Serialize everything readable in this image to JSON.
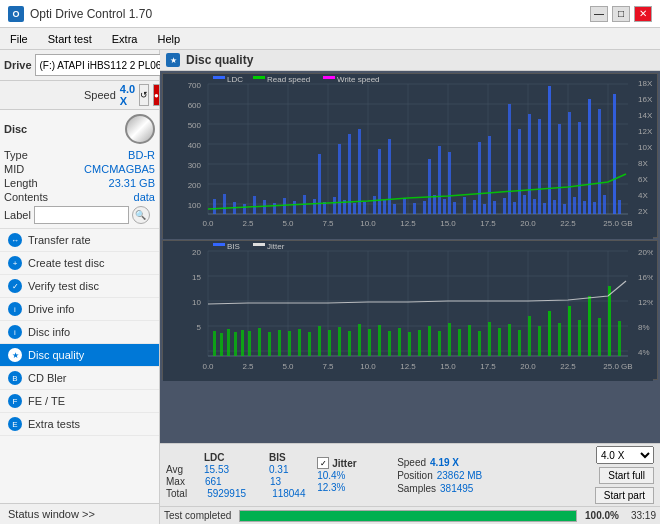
{
  "titlebar": {
    "icon_text": "O",
    "title": "Opti Drive Control 1.70",
    "min_btn": "—",
    "max_btn": "□",
    "close_btn": "✕"
  },
  "menubar": {
    "items": [
      "File",
      "Start test",
      "Extra",
      "Help"
    ]
  },
  "drive": {
    "label": "Drive",
    "value": "(F:) ATAPI iHBS112  2 PL06",
    "speed_label": "Speed",
    "speed_value": "4.0 X"
  },
  "disc": {
    "title": "Disc",
    "type_label": "Type",
    "type_value": "BD-R",
    "mid_label": "MID",
    "mid_value": "CMCMAGBA5",
    "length_label": "Length",
    "length_value": "23.31 GB",
    "contents_label": "Contents",
    "contents_value": "data",
    "label_label": "Label",
    "label_value": ""
  },
  "nav": {
    "items": [
      {
        "label": "Transfer rate",
        "active": false
      },
      {
        "label": "Create test disc",
        "active": false
      },
      {
        "label": "Verify test disc",
        "active": false
      },
      {
        "label": "Drive info",
        "active": false
      },
      {
        "label": "Disc info",
        "active": false
      },
      {
        "label": "Disc quality",
        "active": true
      },
      {
        "label": "CD Bler",
        "active": false
      },
      {
        "label": "FE / TE",
        "active": false
      },
      {
        "label": "Extra tests",
        "active": false
      }
    ]
  },
  "status_window": {
    "label": "Status window >>"
  },
  "dq": {
    "title": "Disc quality",
    "legend_top": [
      "LDC",
      "Read speed",
      "Write speed"
    ],
    "legend_bottom": [
      "BIS",
      "Jitter"
    ]
  },
  "stats": {
    "ldc_label": "LDC",
    "bis_label": "BIS",
    "jitter_label": "Jitter",
    "jitter_checked": true,
    "speed_label": "Speed",
    "speed_value": "4.19 X",
    "speed_select": "4.0 X",
    "position_label": "Position",
    "position_value": "23862 MB",
    "samples_label": "Samples",
    "samples_value": "381495",
    "avg_label": "Avg",
    "avg_ldc": "15.53",
    "avg_bis": "0.31",
    "avg_jitter": "10.4%",
    "max_label": "Max",
    "max_ldc": "661",
    "max_bis": "13",
    "max_jitter": "12.3%",
    "total_label": "Total",
    "total_ldc": "5929915",
    "total_bis": "118044",
    "start_full_btn": "Start full",
    "start_part_btn": "Start part"
  },
  "bottom": {
    "status_text": "Test completed",
    "progress": 100,
    "time": "33:19"
  },
  "chart_top": {
    "y_left_max": 700,
    "y_right_labels": [
      "18X",
      "16X",
      "14X",
      "12X",
      "10X",
      "8X",
      "6X",
      "4X",
      "2X"
    ],
    "x_labels": [
      "0.0",
      "2.5",
      "5.0",
      "7.5",
      "10.0",
      "12.5",
      "15.0",
      "17.5",
      "20.0",
      "22.5",
      "25.0 GB"
    ]
  },
  "chart_bottom": {
    "y_left_max": 20,
    "y_right_labels": [
      "20%",
      "16%",
      "12%",
      "8%",
      "4%"
    ],
    "x_labels": [
      "0.0",
      "2.5",
      "5.0",
      "7.5",
      "10.0",
      "12.5",
      "15.0",
      "17.5",
      "20.0",
      "22.5",
      "25.0 GB"
    ]
  }
}
